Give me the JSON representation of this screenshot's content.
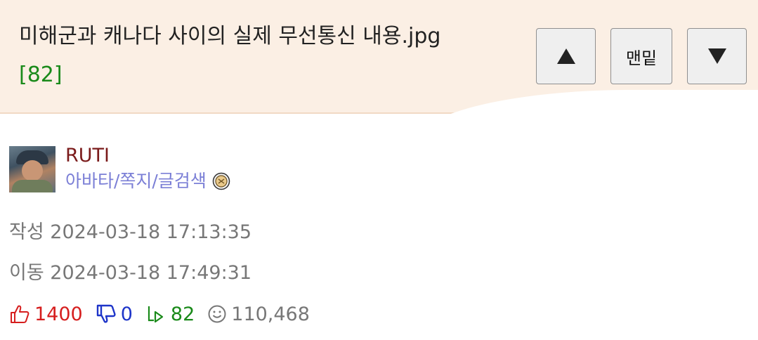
{
  "header": {
    "title": "미해군과 캐나다 사이의 실제 무선통신 내용.jpg",
    "comment_count": "[82]"
  },
  "nav": {
    "up_icon": "triangle-up-icon",
    "bottom_label": "맨밑",
    "down_icon": "triangle-down-icon"
  },
  "author": {
    "nickname": "RUTI",
    "links": "아바타/쪽지/글검색",
    "badge_icon": "level-badge-icon"
  },
  "post": {
    "created": "작성 2024-03-18 17:13:35",
    "moved": "이동 2024-03-18 17:49:31"
  },
  "stats": {
    "upvotes": "1400",
    "downvotes": "0",
    "replies": "82",
    "views": "110,468"
  },
  "colors": {
    "header_bg": "#fbefe4",
    "count_green": "#1a8a1a",
    "nick_red": "#7a1a1a",
    "link_purple": "#7b7fd6",
    "up_red": "#d61e1e",
    "down_blue": "#1e35c9"
  }
}
